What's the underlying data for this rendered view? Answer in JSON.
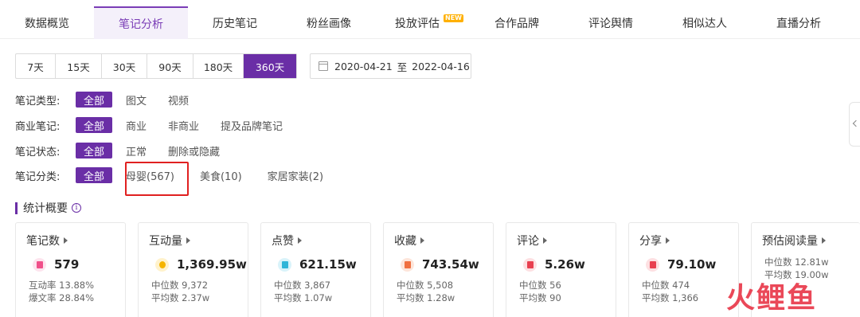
{
  "tabs": [
    {
      "label": "数据概览",
      "active": false
    },
    {
      "label": "笔记分析",
      "active": true
    },
    {
      "label": "历史笔记",
      "active": false
    },
    {
      "label": "粉丝画像",
      "active": false
    },
    {
      "label": "投放评估",
      "active": false,
      "badge": "NEW"
    },
    {
      "label": "合作品牌",
      "active": false
    },
    {
      "label": "评论舆情",
      "active": false
    },
    {
      "label": "相似达人",
      "active": false
    },
    {
      "label": "直播分析",
      "active": false
    }
  ],
  "ranges": [
    {
      "label": "7天",
      "active": false
    },
    {
      "label": "15天",
      "active": false
    },
    {
      "label": "30天",
      "active": false
    },
    {
      "label": "90天",
      "active": false
    },
    {
      "label": "180天",
      "active": false
    },
    {
      "label": "360天",
      "active": true
    }
  ],
  "date_range": {
    "start": "2020-04-21",
    "separator": "至",
    "end": "2022-04-16"
  },
  "filters": [
    {
      "label": "笔记类型:",
      "options": [
        "全部",
        "图文",
        "视频"
      ],
      "selected": 0
    },
    {
      "label": "商业笔记:",
      "options": [
        "全部",
        "商业",
        "非商业",
        "提及品牌笔记"
      ],
      "selected": 0
    },
    {
      "label": "笔记状态:",
      "options": [
        "全部",
        "正常",
        "删除或隐藏"
      ],
      "selected": 0
    },
    {
      "label": "笔记分类:",
      "options": [
        "全部",
        "母婴(567)",
        "美食(10)",
        "家居家装(2)"
      ],
      "selected": 0
    }
  ],
  "section": {
    "title": "统计概要",
    "info_icon": "info-icon"
  },
  "cards": [
    {
      "title": "笔记数",
      "value": "579",
      "icon": "note-icon",
      "icon_color": "#f0508a",
      "icon_bg": "#fde4ee",
      "lines": [
        "互动率 13.88%",
        "爆文率 28.84%"
      ]
    },
    {
      "title": "互动量",
      "value": "1,369.95w",
      "icon": "bulb-icon",
      "icon_color": "#f5b400",
      "icon_bg": "#fff2cc",
      "lines": [
        "中位数 9,372",
        "平均数 2.37w"
      ]
    },
    {
      "title": "点赞",
      "value": "621.15w",
      "icon": "thumb-up-icon",
      "icon_color": "#2fb5d8",
      "icon_bg": "#d9f3fa",
      "lines": [
        "中位数 3,867",
        "平均数 1.07w"
      ]
    },
    {
      "title": "收藏",
      "value": "743.54w",
      "icon": "bookmark-icon",
      "icon_color": "#f07040",
      "icon_bg": "#fde5da",
      "lines": [
        "中位数 5,508",
        "平均数 1.28w"
      ]
    },
    {
      "title": "评论",
      "value": "5.26w",
      "icon": "comment-icon",
      "icon_color": "#e84050",
      "icon_bg": "#fde0e2",
      "lines": [
        "中位数 56",
        "平均数 90"
      ]
    },
    {
      "title": "分享",
      "value": "79.10w",
      "icon": "share-icon",
      "icon_color": "#e84050",
      "icon_bg": "#fde0e2",
      "lines": [
        "中位数 474",
        "平均数 1,366"
      ]
    },
    {
      "title": "预估阅读量",
      "value": "",
      "icon": "",
      "icon_color": "",
      "icon_bg": "",
      "lines": [
        "中位数 12.81w",
        "平均数 19.00w"
      ]
    }
  ],
  "watermark": {
    "text": "火鲤鱼",
    "color": "#e8384a"
  },
  "colors": {
    "accent": "#6a2ea6",
    "highlight": "#e02020"
  }
}
